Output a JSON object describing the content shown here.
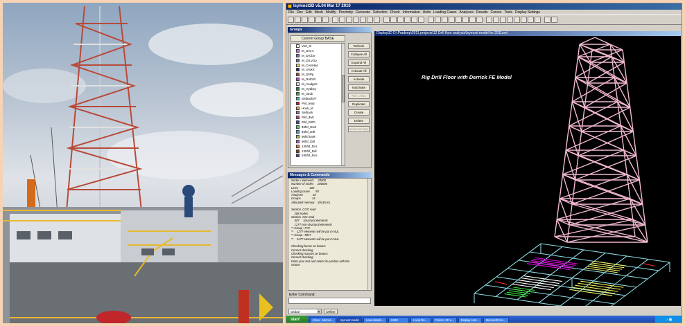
{
  "app": {
    "title": "Isymost3D v5.04 Mar 17 2010",
    "menus": [
      "File",
      "Doc",
      "Edit",
      "Mesh",
      "Modify",
      "Proximity",
      "Generate",
      "Selection",
      "Check",
      "Information",
      "Units",
      "Loading Cases",
      "Analyses",
      "Results",
      "Curves",
      "Tools",
      "Display Settings"
    ]
  },
  "groups": {
    "title": "Groups",
    "current_group_label": "Current Group BASE",
    "items": [
      {
        "label": "Vert_ld",
        "color": "#ffffff"
      },
      {
        "label": "M_DrvrA",
        "color": "#d070d0"
      },
      {
        "label": "M_DrCbn",
        "color": "#8070c0"
      },
      {
        "label": "M_DrLvGp",
        "color": "#6080a0"
      },
      {
        "label": "M_CentHan",
        "color": "#f0d060"
      },
      {
        "label": "M_chokX",
        "color": "#202080"
      },
      {
        "label": "M_StrPp",
        "color": "#a05050"
      },
      {
        "label": "M_RotbDr",
        "color": "#c040c0"
      },
      {
        "label": "M_mudgsX",
        "color": "#e0e0e0"
      },
      {
        "label": "M_Hydkey",
        "color": "#208040"
      },
      {
        "label": "M_Iarub",
        "color": "#40a040"
      },
      {
        "label": "SetbackVT",
        "color": "#40c0c0"
      },
      {
        "label": "Pist_lead",
        "color": "#c02020"
      },
      {
        "label": "Hook_ld",
        "color": "#e0a040"
      },
      {
        "label": "Setback",
        "color": "#8080c0"
      },
      {
        "label": "0fsf_dwk",
        "color": "#c04080"
      },
      {
        "label": "0fsf_DdPl",
        "color": "#4040a0"
      },
      {
        "label": "45fsf_Dwk",
        "color": "#60c060"
      },
      {
        "label": "45fsf_Ddl",
        "color": "#40a0e0"
      },
      {
        "label": "90fsf Dwk",
        "color": "#a0c040"
      },
      {
        "label": "90fsf_Ddl",
        "color": "#c060c0"
      },
      {
        "label": "135fsf_Dcs",
        "color": "#e08040"
      },
      {
        "label": "135fsf_Ddl",
        "color": "#804000"
      },
      {
        "label": "180fsf_Dxs",
        "color": "#6040a0"
      }
    ],
    "buttons": {
      "refresh": "Refresh",
      "collapse_all": "Collapse All",
      "expand_all": "Expand All",
      "activate_all": "Activate All",
      "activate": "Activate",
      "inactivate": "Inactivate",
      "rename": "Ren. Alias",
      "duplicate": "Duplicate",
      "create": "Create",
      "delete": "Delete",
      "delete_empty": "Delete Empty"
    }
  },
  "messages": {
    "title": "Messages & Commands",
    "lines": [
      "Nodes / elements     20000",
      "Number of nodes     200000",
      "Lines              100",
      "Loading cases       50",
      "Analyses            10",
      "Groups              16",
      "Allocated memory    30415 Ko",
      "",
      "Section .COO read",
      "    288 nodes",
      "Section .INC read",
      "    507     structural elements",
      "    1277 non-structural elements",
      "** Group : P!!!!",
      "**    1277 elements will be put in NUL",
      "** Group : Mk!7",
      "**    1277 elements will be put in NUL",
      "",
      "Checking forces on beams",
      "Correct checking",
      "Checking masses on beams",
      "Correct checking",
      "Enter your text and select its position with the",
      "mouse"
    ],
    "command_label": "Enter Command:"
  },
  "statusbar": {
    "coord_system": "Global",
    "define_label": "Define"
  },
  "display": {
    "title": "Display3D    D:\\Pradeep\\2011 projects\\12 Drill floor analysis\\Isymost model for 2911xml",
    "model_label": "Rig Drill Floor with Derrick FE Model"
  },
  "taskbar": {
    "start_label": "start",
    "tasks": [
      "Inbox - Micros...",
      "Isymost model",
      "Load details...",
      "ISMS",
      "Local Dri...",
      "Pointer 3D e...",
      "Display cont...",
      "Microsoft Exc..."
    ],
    "active_task_index": 1
  }
}
